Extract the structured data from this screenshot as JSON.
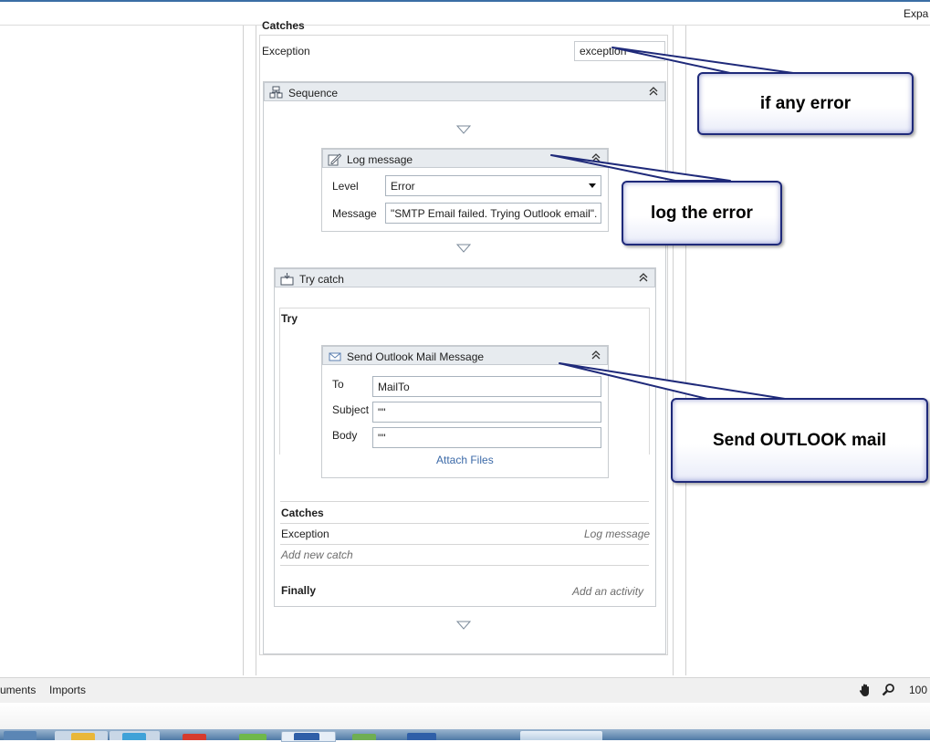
{
  "header": {
    "expand_label": "Expa"
  },
  "outer": {
    "catches_heading": "Catches",
    "exception_label": "Exception",
    "exception_value": "exception"
  },
  "sequence": {
    "title": "Sequence"
  },
  "log_message": {
    "title": "Log message",
    "level_label": "Level",
    "level_value": "Error",
    "message_label": "Message",
    "message_value": "\"SMTP Email failed. Trying Outlook email\"."
  },
  "try_catch": {
    "title": "Try catch",
    "try_label": "Try",
    "catches_label": "Catches",
    "exception_label": "Exception",
    "exception_handler": "Log message",
    "add_new_catch": "Add new catch",
    "finally_label": "Finally",
    "add_activity": "Add an activity"
  },
  "send_outlook": {
    "title": "Send Outlook Mail Message",
    "to_label": "To",
    "to_value": "MailTo",
    "subject_label": "Subject",
    "subject_value": "\"\"",
    "body_label": "Body",
    "body_value": "\"\"",
    "attach_files": "Attach Files"
  },
  "callouts": {
    "if_any_error": "if any error",
    "log_the_error": "log the error",
    "send_outlook_mail": "Send OUTLOOK mail"
  },
  "statusbar": {
    "arguments_tab": "uments",
    "imports_tab": "Imports",
    "zoom": "100"
  },
  "icons": [
    "sequence-icon",
    "log-message-icon",
    "try-catch-icon",
    "mail-icon",
    "collapse-icon",
    "hand-icon",
    "zoom-icon"
  ]
}
